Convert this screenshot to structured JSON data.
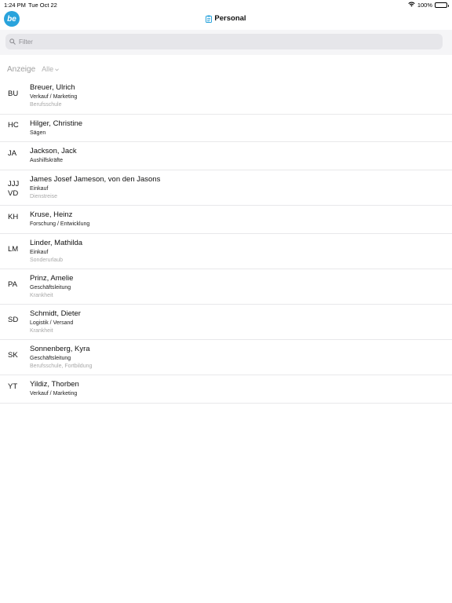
{
  "status_bar": {
    "time": "1:24 PM",
    "date": "Tue Oct 22",
    "battery": "100%"
  },
  "nav": {
    "logo_text": "be",
    "title": "Personal"
  },
  "search": {
    "placeholder": "Filter"
  },
  "filter": {
    "label": "Anzeige",
    "value": "Alle"
  },
  "employees": [
    {
      "initials": "BU",
      "name": "Breuer, Ulrich",
      "department": "Verkauf / Marketing",
      "absence": "Berufsschule"
    },
    {
      "initials": "HC",
      "name": "Hilger, Christine",
      "department": "Sägen",
      "absence": ""
    },
    {
      "initials": "JA",
      "name": "Jackson, Jack",
      "department": "Aushilfskräfte",
      "absence": ""
    },
    {
      "initials": "JJJ\nVD",
      "name": "James Josef Jameson, von den Jasons",
      "department": "Einkauf",
      "absence": "Dienstreise"
    },
    {
      "initials": "KH",
      "name": "Kruse, Heinz",
      "department": "Forschung / Entwicklung",
      "absence": ""
    },
    {
      "initials": "LM",
      "name": "Linder, Mathilda",
      "department": "Einkauf",
      "absence": "Sonderurlaub"
    },
    {
      "initials": "PA",
      "name": "Prinz, Amelie",
      "department": "Geschäftsleitung",
      "absence": "Krankheit"
    },
    {
      "initials": "SD",
      "name": "Schmidt, Dieter",
      "department": "Logistik / Versand",
      "absence": "Krankheit"
    },
    {
      "initials": "SK",
      "name": "Sonnenberg, Kyra",
      "department": "Geschäftsleitung",
      "absence": "Berufsschule, Fortbildung"
    },
    {
      "initials": "YT",
      "name": "Yildiz, Thorben",
      "department": "Verkauf / Marketing",
      "absence": ""
    }
  ],
  "colors": {
    "accent": "#29a3dc",
    "separator": "#e8e8ea",
    "muted_text": "#a8a8a8"
  }
}
